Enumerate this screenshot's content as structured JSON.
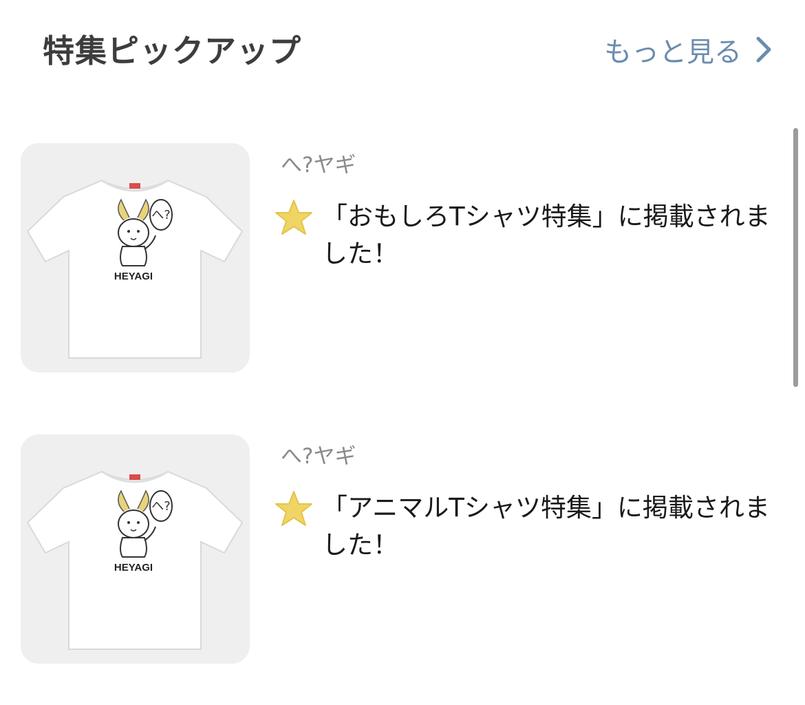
{
  "header": {
    "title": "特集ピックアップ",
    "see_more_label": "もっと見る"
  },
  "features": [
    {
      "shop_name": "へ?ヤギ",
      "description": "「おもしろTシャツ特集」に掲載されました！",
      "product_print_text": "HEYAGI",
      "speech_bubble_text": "へ?"
    },
    {
      "shop_name": "へ?ヤギ",
      "description": "「アニマルTシャツ特集」に掲載されました！",
      "product_print_text": "HEYAGI",
      "speech_bubble_text": "へ?"
    }
  ],
  "colors": {
    "link": "#6b8cae",
    "star": "#f0d565",
    "title": "#3d3d3d",
    "thumb_bg": "#efefef"
  },
  "icons": {
    "see_more": "chevron-right-icon",
    "badge": "star-icon"
  }
}
